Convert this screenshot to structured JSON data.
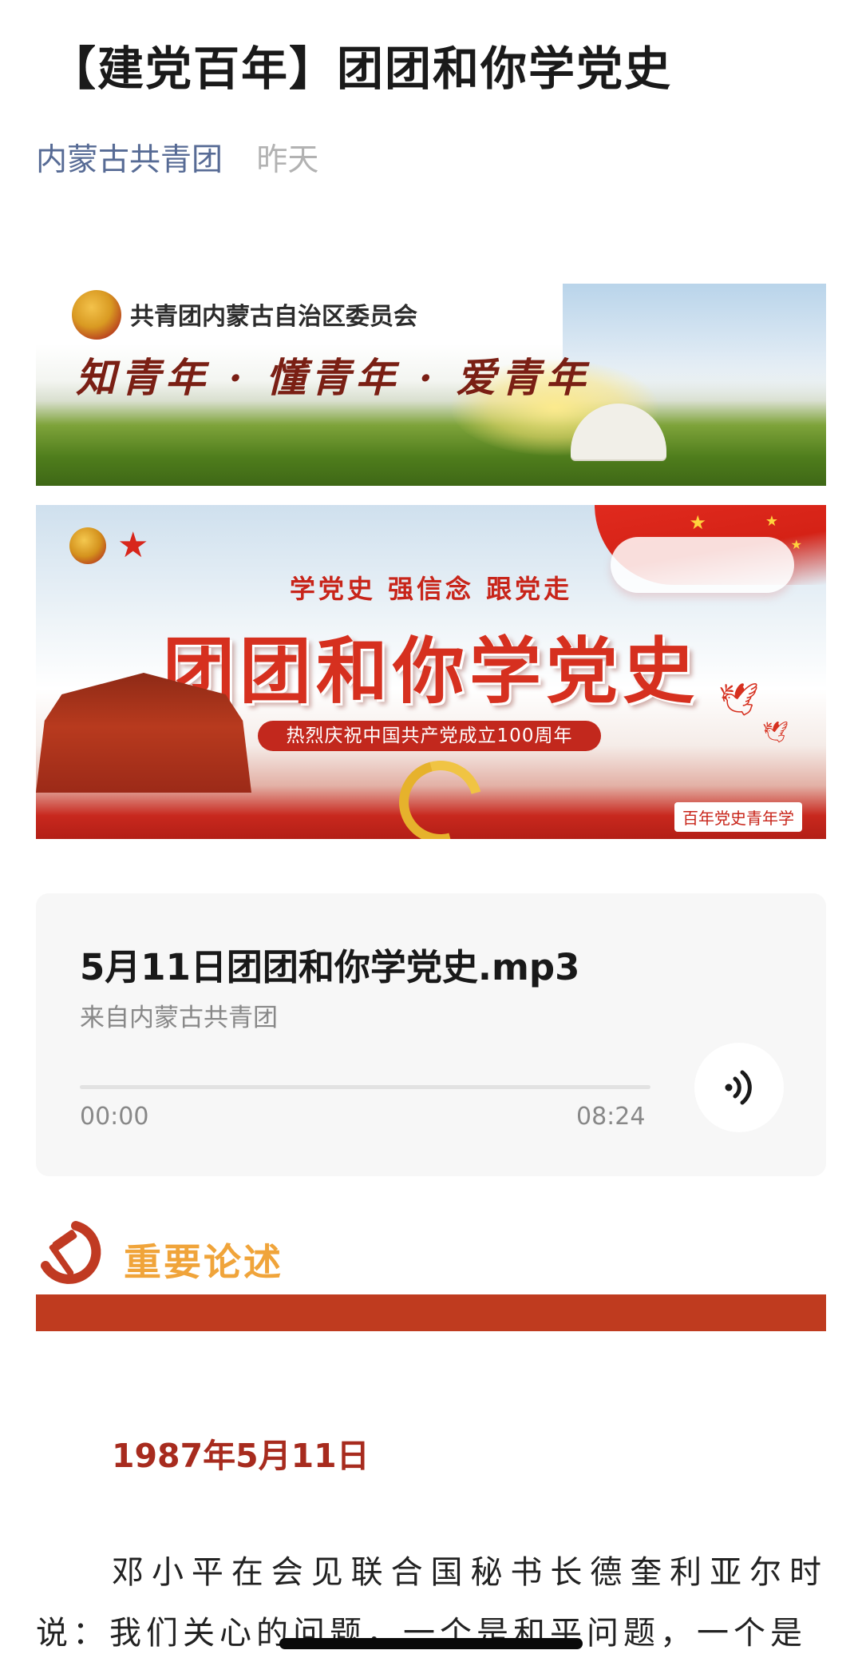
{
  "article": {
    "title": "【建党百年】团团和你学党史",
    "account": "内蒙古共青团",
    "time": "昨天"
  },
  "banner1": {
    "org": "共青团内蒙古自治区委员会",
    "slogan": "知青年 · 懂青年 · 爱青年"
  },
  "banner2": {
    "subtitle": "学党史  强信念  跟党走",
    "title": "团团和你学党史",
    "pill": "热烈庆祝中国共产党成立100周年",
    "tag": "百年党史青年学"
  },
  "audio": {
    "name": "5月11日团团和你学党史.mp3",
    "source": "来自内蒙古共青团",
    "current": "00:00",
    "duration": "08:24",
    "progress": 0,
    "icon": "sound-wave-icon"
  },
  "section": {
    "title": "重要论述",
    "icon": "hammer-sickle-icon",
    "color": "#bf3b1f"
  },
  "content": {
    "date": "1987年5月11日",
    "paragraph": "邓小平在会见联合国秘书长德奎利亚尔时说：我们关心的问题，一个是和平问题，一个是"
  }
}
